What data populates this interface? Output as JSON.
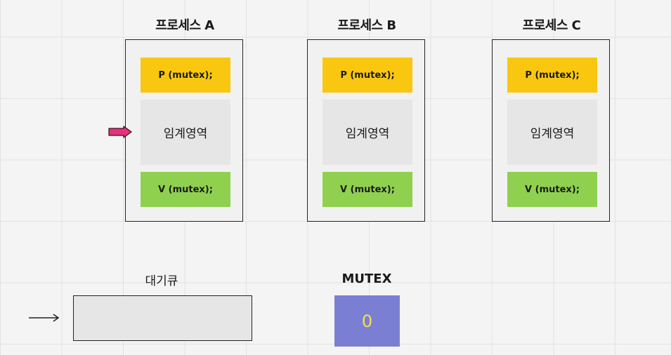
{
  "processes": [
    {
      "title": "프로세스 A",
      "p_label": "P (mutex);",
      "cs_label": "임계영역",
      "v_label": "V (mutex);"
    },
    {
      "title": "프로세스 B",
      "p_label": "P (mutex);",
      "cs_label": "임계영역",
      "v_label": "V (mutex);"
    },
    {
      "title": "프로세스 C",
      "p_label": "P (mutex);",
      "cs_label": "임계영역",
      "v_label": "V (mutex);"
    }
  ],
  "queue": {
    "label": "대기큐"
  },
  "mutex": {
    "label": "MUTEX",
    "value": "0"
  },
  "colors": {
    "p_block": "#fac710",
    "v_block": "#8fd14f",
    "critical_section": "#e6e6e6",
    "mutex_box": "#7b7fd3",
    "mutex_value": "#f4e04d",
    "marker_arrow": "#e6317a"
  }
}
